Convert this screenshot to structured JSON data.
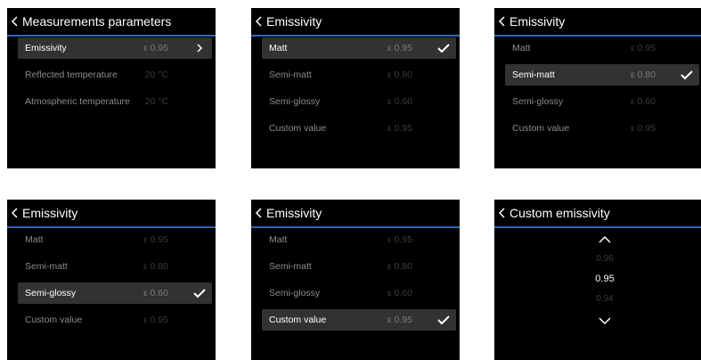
{
  "screens": {
    "measurement_params": {
      "title": "Measurements parameters",
      "rows": [
        {
          "label": "Emissivity",
          "value": "ε 0.95"
        },
        {
          "label": "Reflected temperature",
          "value": "20 °C"
        },
        {
          "label": "Atmospheric temperature",
          "value": "20 °C"
        }
      ]
    },
    "emissivity_matt": {
      "title": "Emissivity",
      "selected": "Matt",
      "rows": [
        {
          "label": "Matt",
          "value": "ε 0.95"
        },
        {
          "label": "Semi-matt",
          "value": "ε 0.80"
        },
        {
          "label": "Semi-glossy",
          "value": "ε 0.60"
        },
        {
          "label": "Custom value",
          "value": "ε 0.95"
        }
      ]
    },
    "emissivity_semi_matt": {
      "title": "Emissivity",
      "selected": "Semi-matt",
      "rows": [
        {
          "label": "Matt",
          "value": "ε 0.95"
        },
        {
          "label": "Semi-matt",
          "value": "ε 0.80"
        },
        {
          "label": "Semi-glossy",
          "value": "ε 0.60"
        },
        {
          "label": "Custom value",
          "value": "ε 0.95"
        }
      ]
    },
    "emissivity_semi_glossy": {
      "title": "Emissivity",
      "selected": "Semi-glossy",
      "rows": [
        {
          "label": "Matt",
          "value": "ε 0.95"
        },
        {
          "label": "Semi-matt",
          "value": "ε 0.80"
        },
        {
          "label": "Semi-glossy",
          "value": "ε 0.60"
        },
        {
          "label": "Custom value",
          "value": "ε 0.95"
        }
      ]
    },
    "emissivity_custom": {
      "title": "Emissivity",
      "selected": "Custom value",
      "rows": [
        {
          "label": "Matt",
          "value": "ε 0.95"
        },
        {
          "label": "Semi-matt",
          "value": "ε 0.80"
        },
        {
          "label": "Semi-glossy",
          "value": "ε 0.60"
        },
        {
          "label": "Custom value",
          "value": "ε 0.95"
        }
      ]
    },
    "custom_emissivity": {
      "title": "Custom emissivity",
      "above_value": "0.96",
      "current_value": "0.95",
      "below_value": "0.94"
    }
  },
  "icons": {
    "back": "chevron-left-icon",
    "forward": "chevron-right-icon",
    "selected": "checkmark-icon",
    "increase": "chevron-up-icon",
    "decrease": "chevron-down-icon"
  },
  "colors": {
    "screen_background": "#000000",
    "header_underline": "#2f66b8",
    "selected_row": "#323232",
    "text_primary": "#ffffff",
    "text_secondary": "#8c8c8c",
    "text_value": "#3a3a3a"
  }
}
